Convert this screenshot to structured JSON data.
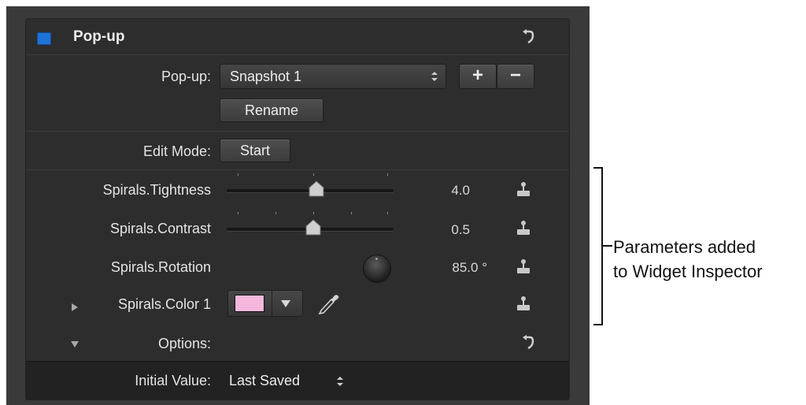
{
  "header": {
    "title": "Pop-up"
  },
  "popup_row": {
    "label": "Pop-up:",
    "selected": "Snapshot 1",
    "add_label": "+",
    "remove_label": "−"
  },
  "rename_button": {
    "label": "Rename"
  },
  "edit_mode": {
    "label": "Edit Mode:",
    "button": "Start"
  },
  "parameters": [
    {
      "label": "Spirals.Tightness",
      "value": "4.0",
      "slider_fraction": 0.53
    },
    {
      "label": "Spirals.Contrast",
      "value": "0.5",
      "slider_fraction": 0.52
    },
    {
      "label": "Spirals.Rotation",
      "value": "85.0 °"
    },
    {
      "label": "Spirals.Color 1",
      "swatch_color": "#f5b8dc"
    }
  ],
  "options": {
    "label": "Options:"
  },
  "initial_value": {
    "label": "Initial Value:",
    "value": "Last Saved"
  },
  "annotation": {
    "line1": "Parameters added",
    "line2": "to Widget Inspector"
  },
  "colors": {
    "accent_checkbox": "#1e73d6",
    "panel": "#2d2d2d",
    "footer": "#222222"
  }
}
